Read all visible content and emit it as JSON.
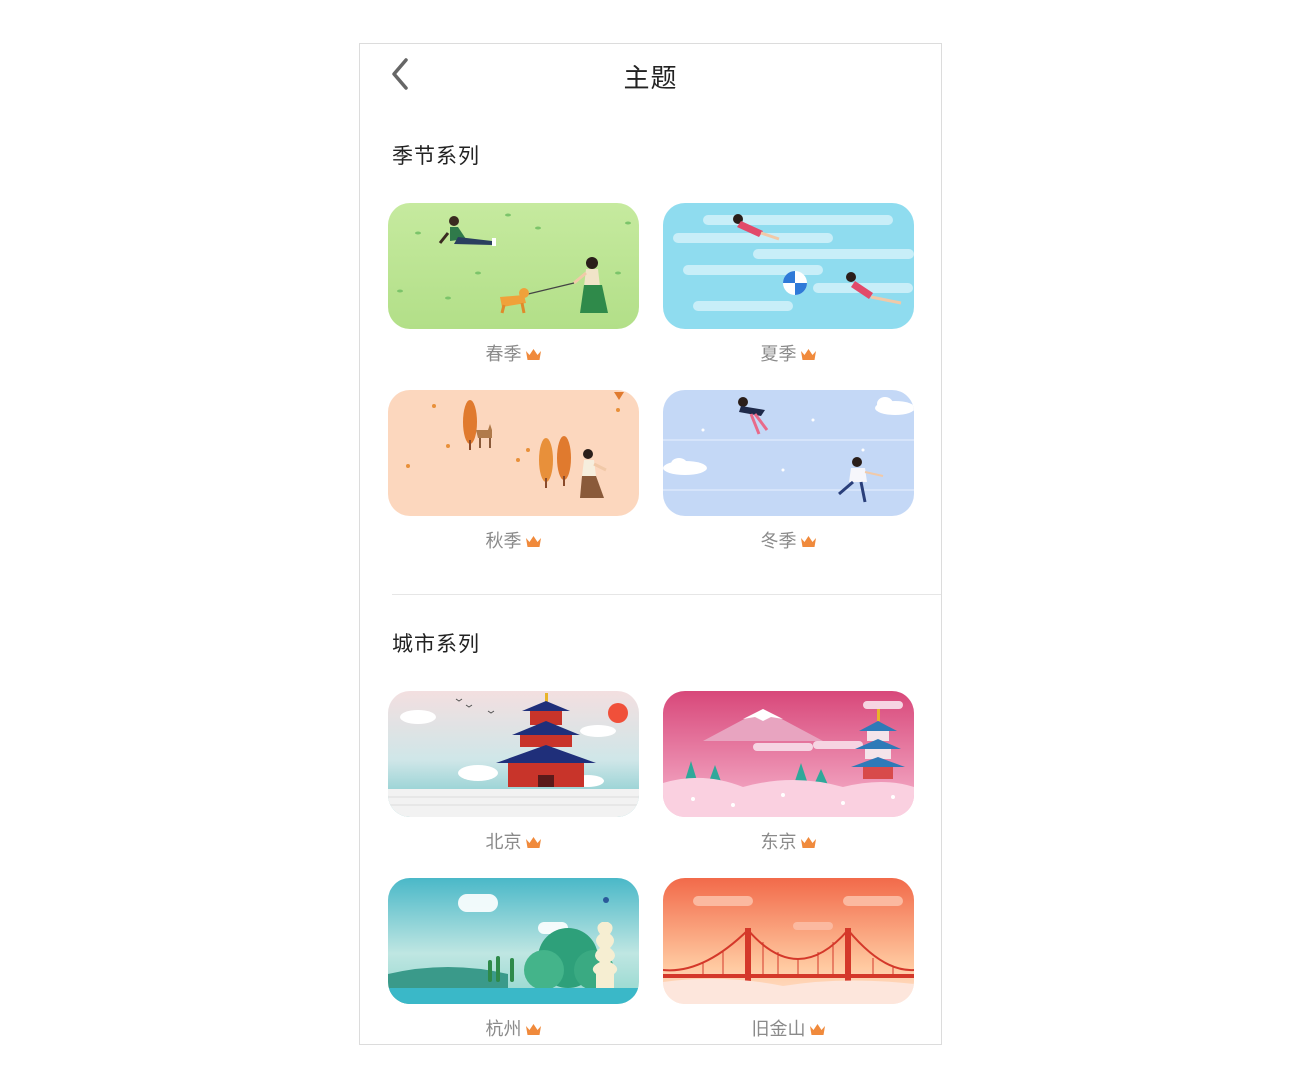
{
  "header": {
    "title": "主题",
    "back_icon": "chevron-left-icon"
  },
  "sections": [
    {
      "title": "季节系列",
      "items": [
        {
          "label": "春季",
          "theme": "spring"
        },
        {
          "label": "夏季",
          "theme": "summer"
        },
        {
          "label": "秋季",
          "theme": "autumn"
        },
        {
          "label": "冬季",
          "theme": "winter"
        }
      ]
    },
    {
      "title": "城市系列",
      "items": [
        {
          "label": "北京",
          "theme": "beijing"
        },
        {
          "label": "东京",
          "theme": "tokyo"
        },
        {
          "label": "杭州",
          "theme": "hangzhou"
        },
        {
          "label": "旧金山",
          "theme": "san-francisco"
        }
      ]
    }
  ],
  "colors": {
    "crown": "#f08a3c",
    "label": "#8a8a8a",
    "title": "#222222"
  },
  "premium_icon": "crown-icon"
}
